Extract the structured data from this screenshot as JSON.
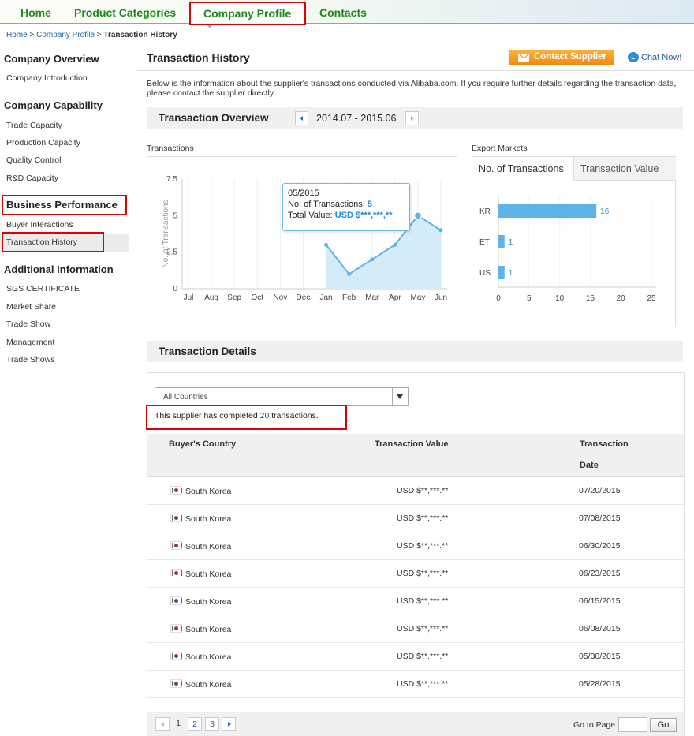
{
  "nav": {
    "items": [
      {
        "label": "Home"
      },
      {
        "label": "Product Categories"
      },
      {
        "label": "Company Profile"
      },
      {
        "label": "Contacts"
      }
    ]
  },
  "breadcrumb": {
    "home": "Home",
    "profile": "Company Profile",
    "current": "Transaction History",
    "sep": ">"
  },
  "sidebar": {
    "sections": [
      {
        "title": "Company Overview",
        "items": [
          "Company Introduction"
        ]
      },
      {
        "title": "Company Capability",
        "items": [
          "Trade Capacity",
          "Production Capacity",
          "Quality Control",
          "R&D Capacity"
        ]
      },
      {
        "title": "Business Performance",
        "items": [
          "Buyer Interactions",
          "Transaction History"
        ]
      },
      {
        "title": "Additional Information",
        "items": [
          "SGS CERTIFICATE",
          "Market Share",
          "Trade Show",
          "Management",
          "Trade Shows"
        ]
      }
    ]
  },
  "header": {
    "title": "Transaction History",
    "contact_label": "Contact Supplier",
    "chat_label": "Chat Now!"
  },
  "description": "Below is the information about the supplier's transactions conducted via Alibaba.com. If you require further details regarding the transaction data, please contact the supplier directly.",
  "overview": {
    "title": "Transaction Overview",
    "period": "2014.07 - 2015.06",
    "transactions_label": "Transactions",
    "export_label": "Export Markets"
  },
  "tooltip": {
    "date": "05/2015",
    "count_label": "No. of Transactions:",
    "count": "5",
    "value_label": "Total Value:",
    "value": "USD $***,***,**"
  },
  "export_tabs": {
    "tab1": "No. of Transactions",
    "tab2": "Transaction Value"
  },
  "chart_data": [
    {
      "type": "area",
      "ylabel": "No. of Transactions",
      "categories": [
        "Jul",
        "Aug",
        "Sep",
        "Oct",
        "Nov",
        "Dec",
        "Jan",
        "Feb",
        "Mar",
        "Apr",
        "May",
        "Jun"
      ],
      "values": [
        null,
        null,
        null,
        null,
        null,
        null,
        3,
        1,
        2,
        3,
        5,
        4
      ],
      "yticks": [
        "0",
        "2.5",
        "5",
        "7.5"
      ],
      "ylim": [
        0,
        7.5
      ],
      "color": "#5bb4e5"
    },
    {
      "type": "bar",
      "orientation": "horizontal",
      "categories": [
        "KR",
        "ET",
        "US"
      ],
      "values": [
        16,
        1,
        1
      ],
      "value_labels": [
        "16",
        "1",
        "1"
      ],
      "xticks": [
        "0",
        "5",
        "10",
        "15",
        "20",
        "25"
      ],
      "xlim": [
        0,
        25
      ],
      "color": "#5bb4e5"
    }
  ],
  "details": {
    "title": "Transaction Details",
    "country_select": "All Countries",
    "summary_pre": "This supplier has completed",
    "summary_num": "20",
    "summary_post": "transactions.",
    "columns": {
      "country": "Buyer's Country",
      "value": "Transaction Value",
      "date_line1": "Transaction",
      "date_line2": "Date"
    },
    "rows": [
      {
        "country": "South Korea",
        "value": "USD $**,***.**",
        "date": "07/20/2015"
      },
      {
        "country": "South Korea",
        "value": "USD $**,***.**",
        "date": "07/08/2015"
      },
      {
        "country": "South Korea",
        "value": "USD $**,***.**",
        "date": "06/30/2015"
      },
      {
        "country": "South Korea",
        "value": "USD $**,***.**",
        "date": "06/23/2015"
      },
      {
        "country": "South Korea",
        "value": "USD $**,***.**",
        "date": "06/15/2015"
      },
      {
        "country": "South Korea",
        "value": "USD $**,***.**",
        "date": "06/08/2015"
      },
      {
        "country": "South Korea",
        "value": "USD $**,***.**",
        "date": "05/30/2015"
      },
      {
        "country": "South Korea",
        "value": "USD $**,***.**",
        "date": "05/28/2015"
      }
    ]
  },
  "pager": {
    "p1": "1",
    "p2": "2",
    "p3": "3",
    "goto_label": "Go to Page",
    "go_label": "Go"
  }
}
